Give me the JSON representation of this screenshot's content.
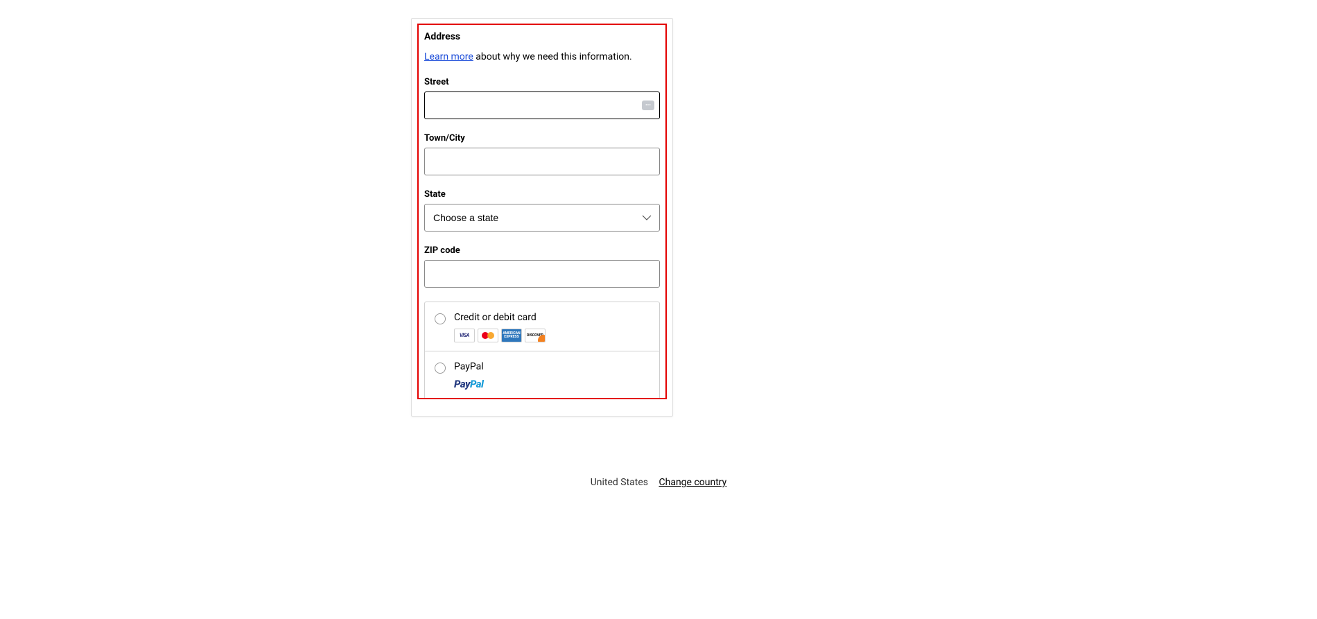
{
  "address": {
    "heading": "Address",
    "learn_more": "Learn more",
    "info_text": " about why we need this information.",
    "street_label": "Street",
    "street_value": "",
    "city_label": "Town/City",
    "city_value": "",
    "state_label": "State",
    "state_placeholder": "Choose a state",
    "zip_label": "ZIP code",
    "zip_value": ""
  },
  "payment": {
    "card_label": "Credit or debit card",
    "paypal_label": "PayPal",
    "icons": {
      "visa": "VISA",
      "amex_line1": "AMERICAN",
      "amex_line2": "EXPRESS",
      "discover": "DISCOVER"
    },
    "paypal_logo_p1": "Pay",
    "paypal_logo_p2": "Pal"
  },
  "footer": {
    "country": "United States",
    "change": "Change country"
  }
}
